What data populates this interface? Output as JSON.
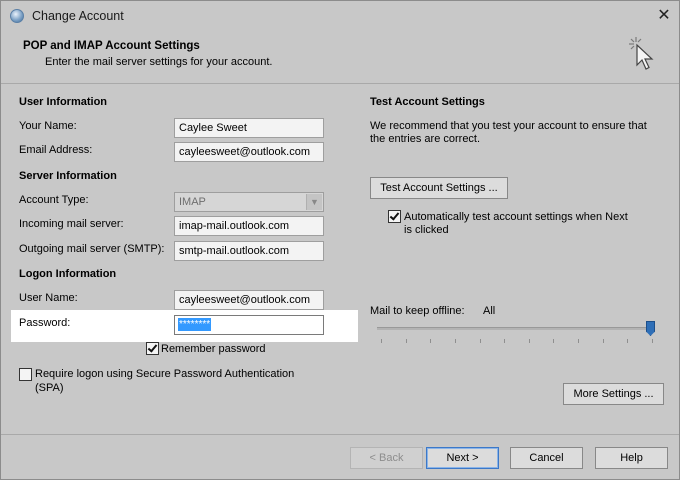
{
  "window": {
    "title": "Change Account"
  },
  "header": {
    "title": "POP and IMAP Account Settings",
    "subtitle": "Enter the mail server settings for your account."
  },
  "user_info": {
    "heading": "User Information",
    "name_label": "Your Name:",
    "name_value": "Caylee Sweet",
    "email_label": "Email Address:",
    "email_value": "cayleesweet@outlook.com"
  },
  "server_info": {
    "heading": "Server Information",
    "type_label": "Account Type:",
    "type_value": "IMAP",
    "incoming_label": "Incoming mail server:",
    "incoming_value": "imap-mail.outlook.com",
    "outgoing_label": "Outgoing mail server (SMTP):",
    "outgoing_value": "smtp-mail.outlook.com"
  },
  "logon_info": {
    "heading": "Logon Information",
    "username_label": "User Name:",
    "username_value": "cayleesweet@outlook.com",
    "password_label": "Password:",
    "password_value": "********",
    "remember_label": "Remember password",
    "remember_checked": true,
    "spa_label_line1": "Require logon using Secure Password Authentication",
    "spa_label_line2": "(SPA)",
    "spa_checked": false
  },
  "test_settings": {
    "heading": "Test Account Settings",
    "desc_line1": "We recommend that you test your account to ensure that",
    "desc_line2": "the entries are correct.",
    "test_button": "Test Account Settings ...",
    "auto_test_line1": "Automatically test account settings when Next",
    "auto_test_line2": "is clicked",
    "auto_test_checked": true
  },
  "offline": {
    "label": "Mail to keep offline:",
    "value": "All",
    "slider_fraction": 1.0
  },
  "more_settings_button": "More Settings ...",
  "footer": {
    "back": "< Back",
    "next": "Next >",
    "cancel": "Cancel",
    "help": "Help"
  },
  "colors": {
    "window_bg": "#c8c8c8",
    "selection": "#3399ff",
    "slider_thumb": "#2f6fb7"
  },
  "icons": [
    "outlook-app-icon",
    "close-icon",
    "wizard-cursor-icon",
    "check-icon",
    "combo-arrow-icon"
  ]
}
